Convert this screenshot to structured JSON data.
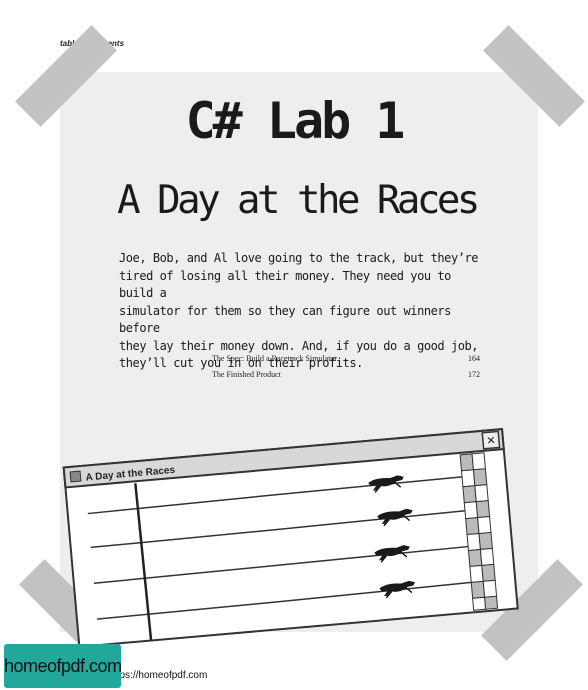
{
  "header": {
    "part1": "table ",
    "part2": "of",
    "part3": " contents"
  },
  "title": "C# Lab 1",
  "subtitle": "A Day at the Races",
  "intro_lines": [
    "Joe, Bob, and Al love going to the track, but they’re",
    "tired of losing all their money. They need you to build a",
    "simulator for them so they can figure out winners before",
    "they lay their money down. And, if you do a good job,",
    "they’ll cut you in on their profits."
  ],
  "toc": [
    {
      "label": "The Spec: Build a Racetrack Simulator",
      "page": "164"
    },
    {
      "label": "The Finished Product",
      "page": "172"
    }
  ],
  "window": {
    "title": "A Day at the Races",
    "close_glyph": "✕"
  },
  "footer": {
    "logo": "homeofpdf.com",
    "visit_text": "For more please visit: https://homeofpdf.com"
  },
  "colors": {
    "panel": "#eeeeee",
    "tape": "#c2c2c2",
    "logo_bg": "#22a89a"
  }
}
